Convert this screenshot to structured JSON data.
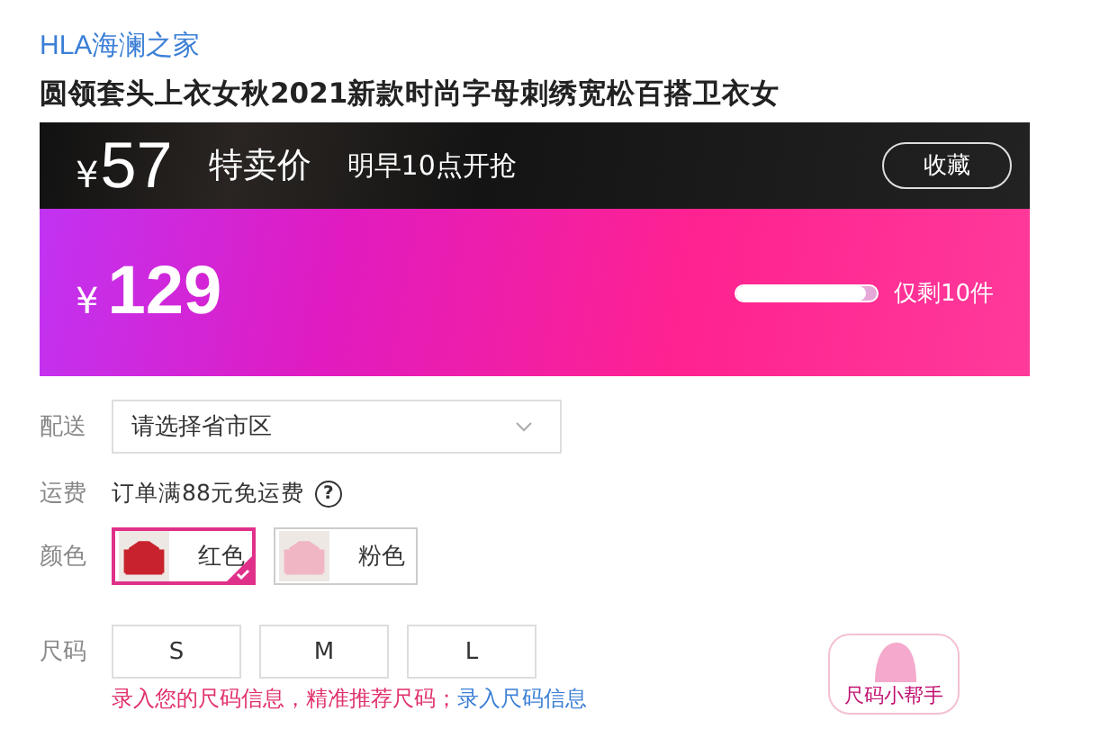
{
  "brand": "HLA海澜之家",
  "title": "圆领套头上衣女秋2021新款时尚字母刺绣宽松百搭卫衣女",
  "promo": {
    "currency": "¥",
    "price": "57",
    "label": "特卖价",
    "start": "明早10点开抢",
    "favorite_button": "收藏"
  },
  "price_panel": {
    "currency": "¥",
    "price": "129",
    "stock": {
      "level": 0.92,
      "text": "仅剩10件"
    }
  },
  "delivery": {
    "label": "配送",
    "placeholder": "请选择省市区"
  },
  "shipping": {
    "label": "运费",
    "text": "订单满88元免运费",
    "help": "?"
  },
  "color": {
    "label": "颜色",
    "options": [
      {
        "name": "红色",
        "selected": true
      },
      {
        "name": "粉色",
        "selected": false
      }
    ]
  },
  "size": {
    "label": "尺码",
    "options": [
      {
        "name": "S",
        "selected": false
      },
      {
        "name": "M",
        "selected": false
      },
      {
        "name": "L",
        "selected": false
      }
    ]
  },
  "size_note": {
    "text": "录入您的尺码信息，精准推荐尺码；",
    "link": "录入尺码信息"
  },
  "size_helper": "尺码小帮手"
}
